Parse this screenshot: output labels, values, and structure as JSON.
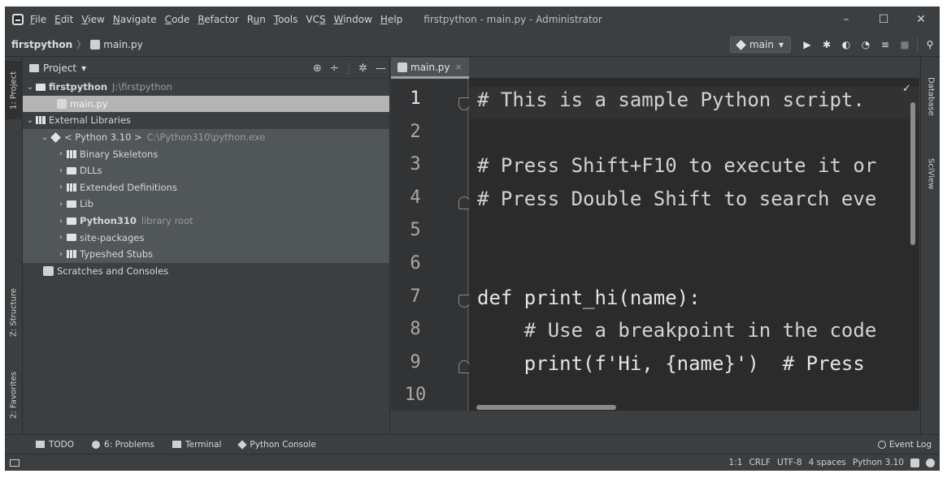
{
  "titlebar": {
    "menu": [
      {
        "label": "File",
        "u": "F",
        "rest": "ile"
      },
      {
        "label": "Edit",
        "u": "E",
        "rest": "dit"
      },
      {
        "label": "View",
        "u": "V",
        "rest": "iew"
      },
      {
        "label": "Navigate",
        "u": "N",
        "rest": "avigate"
      },
      {
        "label": "Code",
        "u": "C",
        "rest": "ode"
      },
      {
        "label": "Refactor",
        "u": "R",
        "rest": "efactor"
      },
      {
        "label": "Run",
        "pre": "R",
        "u": "u",
        "rest": "n"
      },
      {
        "label": "Tools",
        "u": "T",
        "rest": "ools"
      },
      {
        "label": "VCS",
        "pre": "VC",
        "u": "S",
        "rest": ""
      },
      {
        "label": "Window",
        "u": "W",
        "rest": "indow"
      },
      {
        "label": "Help",
        "u": "H",
        "rest": "elp"
      }
    ],
    "window_title": "firstpython - main.py - Administrator",
    "minimize": "–",
    "maximize": "☐",
    "close": "✕"
  },
  "navbar": {
    "project": "firstpython",
    "separator": "〉",
    "file": "main.py",
    "run_config": "main",
    "run_config_arrow": "▾"
  },
  "left_stripe": {
    "project_tab": "1: Project",
    "structure_tab": "Z: Structure",
    "favorites_tab": "2: Favorites"
  },
  "project_panel": {
    "title": "Project",
    "title_arrow": "▾",
    "tree": {
      "root": {
        "name": "firstpython",
        "path": "J:\\firstpython"
      },
      "main_file": "main.py",
      "external": "External Libraries",
      "sdk": {
        "name": "< Python 3.10 >",
        "path": "C:\\Python310\\python.exe"
      },
      "children": [
        {
          "name": "Binary Skeletons",
          "icon": "library-icon",
          "note": ""
        },
        {
          "name": "DLLs",
          "icon": "folder-icon",
          "note": ""
        },
        {
          "name": "Extended Definitions",
          "icon": "library-icon",
          "note": ""
        },
        {
          "name": "Lib",
          "icon": "folder-icon",
          "note": ""
        },
        {
          "name": "Python310",
          "icon": "folder-icon",
          "note": "library root"
        },
        {
          "name": "site-packages",
          "icon": "folder-icon",
          "note": ""
        },
        {
          "name": "Typeshed Stubs",
          "icon": "library-icon",
          "note": ""
        }
      ],
      "scratches": "Scratches and Consoles"
    }
  },
  "editor": {
    "tab_label": "main.py",
    "tab_close": "×",
    "lines": [
      {
        "n": "1",
        "text": "# This is a sample Python script."
      },
      {
        "n": "2",
        "text": ""
      },
      {
        "n": "3",
        "text": "# Press Shift+F10 to execute it or"
      },
      {
        "n": "4",
        "text": "# Press Double Shift to search eve"
      },
      {
        "n": "5",
        "text": ""
      },
      {
        "n": "6",
        "text": ""
      },
      {
        "n": "7",
        "text": "def print_hi(name):"
      },
      {
        "n": "8",
        "text": "    # Use a breakpoint in the code"
      },
      {
        "n": "9",
        "text": "    print(f'Hi, {name}')  # Press"
      },
      {
        "n": "10",
        "text": ""
      }
    ],
    "inspection_mark": "✓"
  },
  "right_stripe": {
    "database_tab": "Database",
    "sciview_tab": "SciView"
  },
  "bottom_tools": [
    {
      "label": "TODO",
      "icon": "todo-icon",
      "pre": "",
      "u": "",
      "rest": "TODO"
    },
    {
      "label": "6: Problems",
      "icon": "problems-icon",
      "pre": "",
      "u": "6",
      "rest": ": Problems"
    },
    {
      "label": "Terminal",
      "icon": "terminal-icon",
      "pre": "",
      "u": "",
      "rest": "Terminal"
    },
    {
      "label": "Python Console",
      "icon": "python-console-icon",
      "pre": "",
      "u": "",
      "rest": "Python Console"
    }
  ],
  "event_log": "Event Log",
  "statusbar": {
    "position": "1:1",
    "line_sep": "CRLF",
    "encoding": "UTF-8",
    "indent": "4 spaces",
    "interpreter": "Python 3.10"
  }
}
